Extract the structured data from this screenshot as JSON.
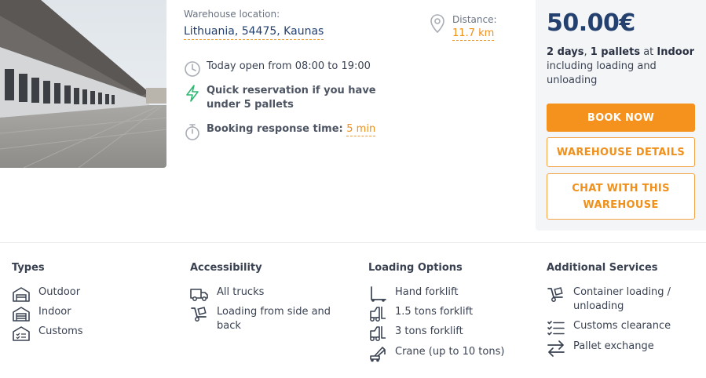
{
  "listing": {
    "photo_alt": "warehouse-photo",
    "location_label": "Warehouse location:",
    "location_value": "Lithuania, 54475, Kaunas",
    "distance_label": "Distance:",
    "distance_value": "11.7 km",
    "hours_text": "Today open from 08:00 to 19:00",
    "quick_reservation_text": "Quick reservation if you have under 5 pallets",
    "response_label": "Booking response time:",
    "response_value": "5 min"
  },
  "pricing": {
    "price": "50.00€",
    "days_bold": "2 days",
    "sep": ", ",
    "pallets_bold": "1 pallets",
    "at_text": " at ",
    "storage_bold": "Indoor",
    "rest": " including loading and unloading",
    "book_now": "BOOK NOW",
    "details": "WAREHOUSE DETAILS",
    "chat": "CHAT WITH THIS WAREHOUSE"
  },
  "features": {
    "types": {
      "title": "Types",
      "items": [
        {
          "label": "Outdoor",
          "icon": "outdoor-warehouse-icon"
        },
        {
          "label": "Indoor",
          "icon": "indoor-warehouse-icon"
        },
        {
          "label": "Customs",
          "icon": "customs-warehouse-icon"
        }
      ]
    },
    "accessibility": {
      "title": "Accessibility",
      "items": [
        {
          "label": "All trucks",
          "icon": "truck-icon"
        },
        {
          "label": "Loading from side and back",
          "icon": "hand-truck-icon"
        }
      ]
    },
    "loading": {
      "title": "Loading Options",
      "items": [
        {
          "label": "Hand forklift",
          "icon": "hand-forklift-icon"
        },
        {
          "label": "1.5 tons forklift",
          "icon": "forklift-icon"
        },
        {
          "label": "3 tons forklift",
          "icon": "forklift-icon"
        },
        {
          "label": "Crane (up to 10 tons)",
          "icon": "crane-icon"
        }
      ]
    },
    "services": {
      "title": "Additional Services",
      "items": [
        {
          "label": "Container loading / unloading",
          "icon": "hand-truck-icon"
        },
        {
          "label": "Customs clearance",
          "icon": "checklist-icon"
        },
        {
          "label": "Pallet exchange",
          "icon": "exchange-arrows-icon"
        }
      ]
    }
  },
  "colors": {
    "accent": "#f5921e",
    "navy": "#24406e",
    "panel": "#f4f5f7",
    "green_bolt": "#2eb872"
  }
}
